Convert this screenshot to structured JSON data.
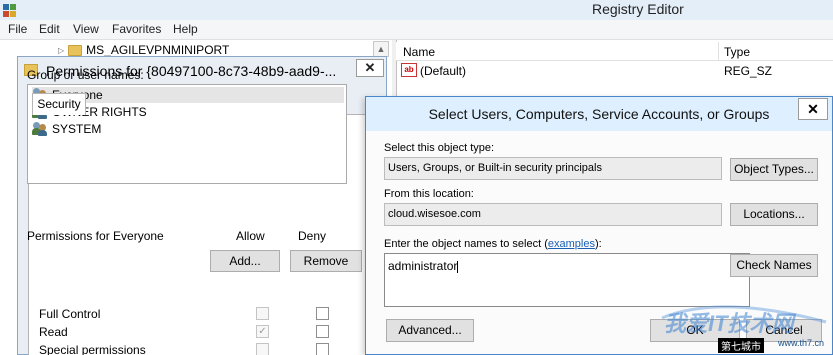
{
  "registry_editor": {
    "title": "Registry Editor",
    "menu": [
      "File",
      "Edit",
      "View",
      "Favorites",
      "Help"
    ],
    "tree": {
      "node_label": "MS_AGILEVPNMINIPORT"
    },
    "list": {
      "columns": {
        "name": "Name",
        "type": "Type"
      },
      "rows": [
        {
          "name": "(Default)",
          "type": "REG_SZ"
        }
      ]
    }
  },
  "permissions_dialog": {
    "title": "Permissions for {80497100-8c73-48b9-aad9-...",
    "close_glyph": "✕",
    "tab_security": "Security",
    "group_label": "Group or user names:",
    "groups": [
      "Everyone",
      "OWNER RIGHTS",
      "SYSTEM"
    ],
    "add_button": "Add...",
    "remove_button": "Remove",
    "perm_for_label": "Permissions for Everyone",
    "allow_label": "Allow",
    "deny_label": "Deny",
    "permissions": [
      {
        "name": "Full Control",
        "allow": false,
        "deny": false
      },
      {
        "name": "Read",
        "allow": true,
        "deny": false
      },
      {
        "name": "Special permissions",
        "allow": false,
        "deny": false
      }
    ]
  },
  "select_users_dialog": {
    "title": "Select Users, Computers, Service Accounts, or Groups",
    "close_glyph": "✕",
    "object_type_label": "Select this object type:",
    "object_type_value": "Users, Groups, or Built-in security principals",
    "object_types_button": "Object Types...",
    "location_label": "From this location:",
    "location_value": "cloud.wisesoe.com",
    "locations_button": "Locations...",
    "enter_names_prefix": "Enter the object names to select (",
    "examples_link": "examples",
    "enter_names_suffix": "):",
    "names_value": "administrator",
    "check_names_button": "Check Names",
    "advanced_button": "Advanced...",
    "ok_button": "OK",
    "cancel_button": "Cancel"
  },
  "watermark": {
    "main_text": "我爱IT技术网",
    "footer_left": "第七城市",
    "footer_right": "www.th7.cn"
  }
}
